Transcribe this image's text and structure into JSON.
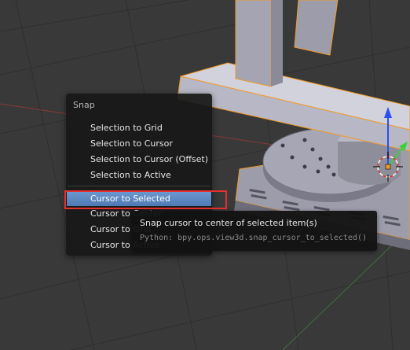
{
  "snap_menu": {
    "title": "Snap",
    "items": [
      {
        "label": "Selection to Grid"
      },
      {
        "label": "Selection to Cursor"
      },
      {
        "label": "Selection to Cursor (Offset)"
      },
      {
        "label": "Selection to Active"
      },
      {
        "label": "Cursor to Selected"
      },
      {
        "label": "Cursor to Center"
      },
      {
        "label": "Cursor to Grid"
      },
      {
        "label": "Cursor to Active"
      }
    ]
  },
  "tooltip": {
    "description": "Snap cursor to center of selected item(s)",
    "python": "Python: bpy.ops.view3d.snap_cursor_to_selected()"
  },
  "colors": {
    "viewport_bg": "#393939",
    "menu_bg": "#181818",
    "active_item": "#5680c2",
    "highlight_box": "#e53030",
    "object_selected_outline": "#f09a28",
    "z_axis": "#2b4ff0",
    "y_axis": "#3ecf3e"
  }
}
